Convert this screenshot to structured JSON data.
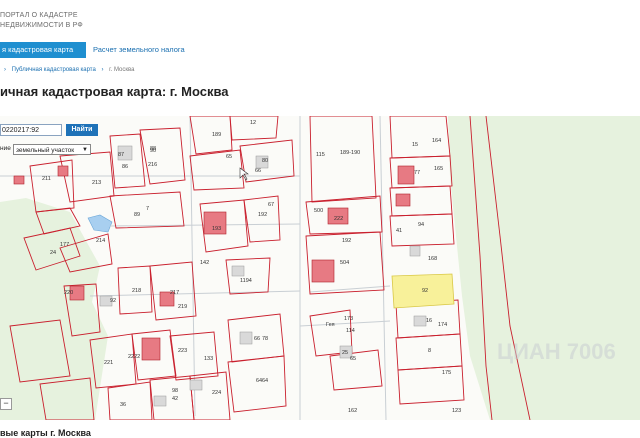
{
  "header": {
    "brand_line1": "ПОРТАЛ О КАДАСТРЕ",
    "brand_line2": "НЕДВИЖИМОСТИ В РФ"
  },
  "nav": {
    "active_tab": "я кадастровая карта",
    "second_tab": "Расчет земельного налога"
  },
  "breadcrumbs": {
    "item1": "Публичная кадастровая карта",
    "item2": "г. Москва"
  },
  "page_title": "ичная кадастровая карта: г. Москва",
  "search": {
    "cad_value": "0220217:92",
    "find_label": "Найти",
    "type_label": "ние",
    "type_value": "земельный участок"
  },
  "map": {
    "accent_color": "#f8f19a",
    "parcel_color": "#c9202e",
    "green_color": "#e6f2de",
    "labels": [
      {
        "t": "189"
      },
      {
        "t": "12"
      },
      {
        "t": "90"
      },
      {
        "t": "65"
      },
      {
        "t": "80"
      },
      {
        "t": "66"
      },
      {
        "t": "87"
      },
      {
        "t": "88"
      },
      {
        "t": "216"
      },
      {
        "t": "86"
      },
      {
        "t": "211"
      },
      {
        "t": "213"
      },
      {
        "t": "7"
      },
      {
        "t": "89"
      },
      {
        "t": "214"
      },
      {
        "t": "177"
      },
      {
        "t": "24"
      },
      {
        "t": "193"
      },
      {
        "t": "192"
      },
      {
        "t": "67"
      },
      {
        "t": "115"
      },
      {
        "t": "189-190"
      },
      {
        "t": "500"
      },
      {
        "t": "222"
      },
      {
        "t": "192"
      },
      {
        "t": "504"
      },
      {
        "t": "15"
      },
      {
        "t": "164"
      },
      {
        "t": "77"
      },
      {
        "t": "165"
      },
      {
        "t": "41"
      },
      {
        "t": "94"
      },
      {
        "t": "168"
      },
      {
        "t": "92"
      },
      {
        "t": "16"
      },
      {
        "t": "174"
      },
      {
        "t": "8"
      },
      {
        "t": "175"
      },
      {
        "t": "142"
      },
      {
        "t": "1194"
      },
      {
        "t": "218"
      },
      {
        "t": "217"
      },
      {
        "t": "219"
      },
      {
        "t": "220"
      },
      {
        "t": "92"
      },
      {
        "t": "221"
      },
      {
        "t": "2222"
      },
      {
        "t": "223"
      },
      {
        "t": "133"
      },
      {
        "t": "66"
      },
      {
        "t": "78"
      },
      {
        "t": "64"
      },
      {
        "t": "173"
      },
      {
        "t": "114"
      },
      {
        "t": "25"
      },
      {
        "t": "65"
      },
      {
        "t": "36"
      },
      {
        "t": "98"
      },
      {
        "t": "42"
      },
      {
        "t": "224"
      },
      {
        "t": "64"
      },
      {
        "t": "123"
      },
      {
        "t": "Гея"
      },
      {
        "t": "162"
      }
    ]
  },
  "watermark": "ЦИАН 7006",
  "bottom_title": "вые карты г. Москва"
}
